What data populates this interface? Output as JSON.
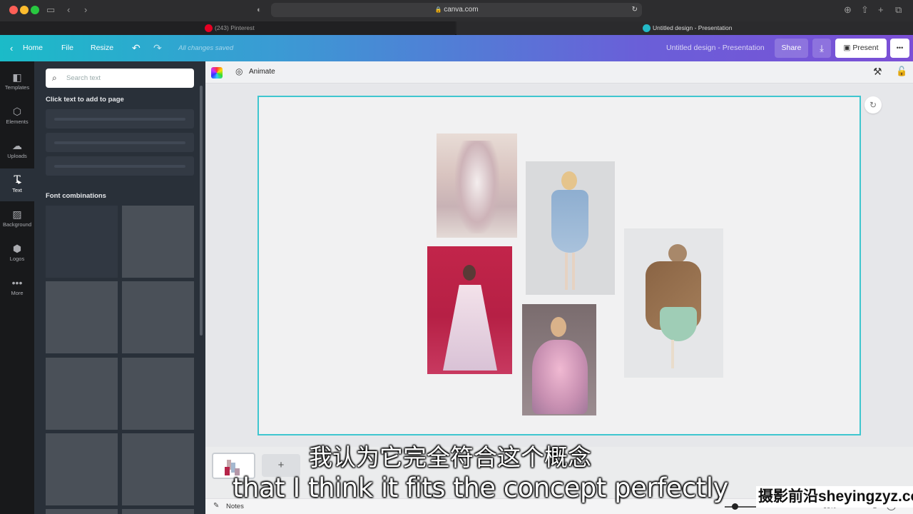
{
  "browser": {
    "url": "canva.com",
    "tabs": [
      {
        "label": "(243) Pinterest"
      },
      {
        "label": "Untitled design - Presentation"
      }
    ]
  },
  "header": {
    "home": "Home",
    "file": "File",
    "resize": "Resize",
    "save_status": "All changes saved",
    "doc_title": "Untitled design - Presentation",
    "share": "Share",
    "present": "Present",
    "more": "•••"
  },
  "rail": {
    "items": [
      {
        "label": "Templates",
        "icon": "templates-icon"
      },
      {
        "label": "Elements",
        "icon": "elements-icon"
      },
      {
        "label": "Uploads",
        "icon": "uploads-icon"
      },
      {
        "label": "Text",
        "icon": "text-icon"
      },
      {
        "label": "Background",
        "icon": "background-icon"
      },
      {
        "label": "Logos",
        "icon": "logos-icon"
      },
      {
        "label": "More",
        "icon": "more-icon"
      }
    ]
  },
  "panel": {
    "search_placeholder": "Search text",
    "click_text_title": "Click text to add to page",
    "font_combinations_title": "Font combinations"
  },
  "toolbar": {
    "animate": "Animate"
  },
  "bottom": {
    "add_page": "+",
    "notes": "Notes",
    "zoom": "66%",
    "page_count": "2"
  },
  "subtitles": {
    "zh": "我认为它完全符合这个概念",
    "en": "that I think it fits the concept perfectly"
  },
  "watermark": "摄影前沿sheyingzyz.com",
  "colors": {
    "accent": "#3fc6cf",
    "header_start": "#1bbbc8",
    "header_end": "#7b4fd6",
    "present_bg": "#ffffff"
  }
}
